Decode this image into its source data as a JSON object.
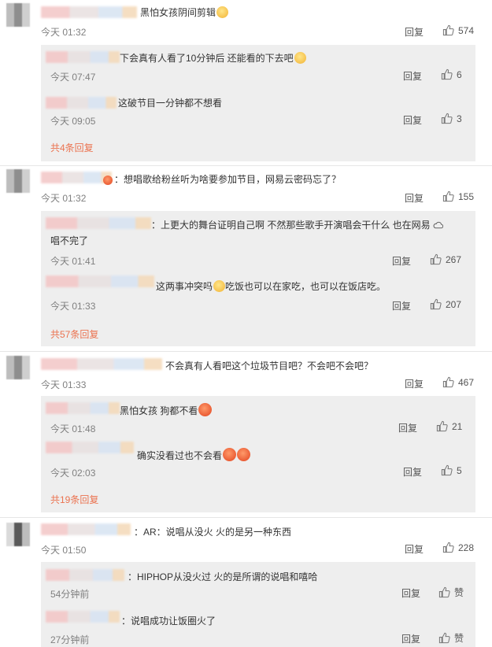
{
  "threads": [
    {
      "text": "黑怕女孩阴间剪辑",
      "time": "今天 01:32",
      "reply": "回复",
      "likes": "574",
      "subs": [
        {
          "text": "下会真有人看了10分钟后 还能看的下去吧",
          "time": "今天 07:47",
          "reply": "回复",
          "likes": "6"
        },
        {
          "text": "这破节目一分钟都不想看",
          "time": "今天 09:05",
          "reply": "回复",
          "likes": "3"
        }
      ],
      "more": "共4条回复"
    },
    {
      "text": "：想唱歌给粉丝听为啥要参加节目，网易云密码忘了？",
      "time": "今天 01:32",
      "reply": "回复",
      "likes": "155",
      "subs": [
        {
          "text": "：上更大的舞台证明自己啊 不然那些歌手开演唱会干什么 也在网易",
          "line2": "唱不完了",
          "time": "今天 01:41",
          "reply": "回复",
          "likes": "267"
        },
        {
          "text": "这两事冲突吗",
          "text_after": "吃饭也可以在家吃，也可以在饭店吃。",
          "time": "今天 01:33",
          "reply": "回复",
          "likes": "207"
        }
      ],
      "more": "共57条回复"
    },
    {
      "text": "不会真有人看吧这个垃圾节目吧？不会吧不会吧？",
      "time": "今天 01:33",
      "reply": "回复",
      "likes": "467",
      "subs": [
        {
          "text": "黑怕女孩 狗都不看",
          "time": "今天 01:48",
          "reply": "回复",
          "likes": "21"
        },
        {
          "text": "确实没看过也不会看",
          "time": "今天 02:03",
          "reply": "回复",
          "likes": "5"
        }
      ],
      "more": "共19条回复"
    },
    {
      "text": "：AR：说唱从没火 火的是另一种东西",
      "time": "今天 01:50",
      "reply": "回复",
      "likes": "228",
      "subs": [
        {
          "text": "：HIPHOP从没火过 火的是所谓的说唱和嘻哈",
          "time": "54分钟前",
          "reply": "回复",
          "likes": "赞"
        },
        {
          "text": "：说唱成功让饭圈火了",
          "time": "27分钟前",
          "reply": "回复",
          "likes": "赞"
        }
      ],
      "more": ""
    }
  ],
  "icons": {
    "like": "thumbs-up-icon",
    "emoji": "emoji-icon",
    "cloud": "cloud-icon"
  },
  "colors": {
    "more_link": "#eb7350",
    "sub_box": "#eeeeee"
  }
}
